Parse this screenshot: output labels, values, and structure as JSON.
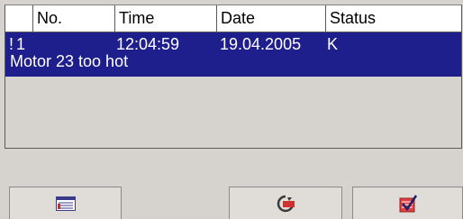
{
  "table": {
    "headers": [
      "",
      "No.",
      "Time",
      "Date",
      "Status"
    ],
    "rows": [
      {
        "mark": "!",
        "no": "1",
        "time": "12:04:59",
        "date": "19.04.2005",
        "status": "K",
        "text": "Motor 23 too hot"
      }
    ]
  },
  "buttons": [
    {
      "icon": "alarm-list-icon"
    },
    {
      "icon": "loop-in-alarm-icon"
    },
    {
      "icon": "acknowledge-icon"
    }
  ],
  "colors": {
    "selection": "#1e1e8c",
    "background": "#d6d3ce",
    "header": "#ffffff"
  }
}
